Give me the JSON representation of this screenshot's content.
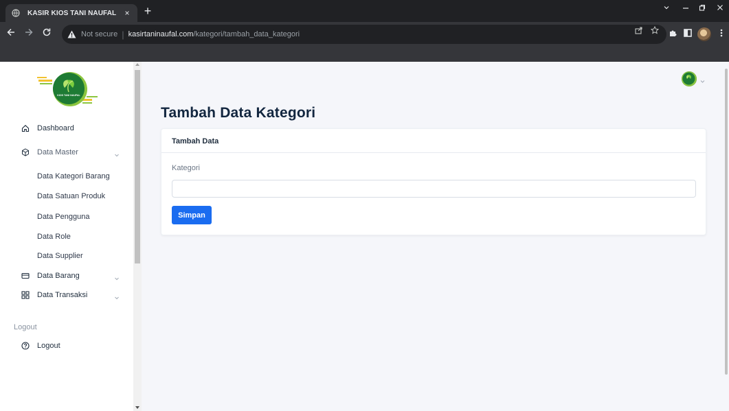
{
  "browser": {
    "tab_title": "KASIR KIOS TANI NAUFAL",
    "tab_close": "×",
    "new_tab": "+",
    "security_label": "Not secure",
    "url_host": "kasirtaninaufal.com",
    "url_path": "/kategori/tambah_data_kategori",
    "separator": "|"
  },
  "sidebar": {
    "logo_text": "KIOS TANI NAUFAL",
    "nav": [
      {
        "label": "Dashboard",
        "icon": "home-icon"
      },
      {
        "label": "Data Master",
        "icon": "cube-icon"
      },
      {
        "label": "Data Kategori Barang"
      },
      {
        "label": "Data Satuan Produk"
      },
      {
        "label": "Data Pengguna"
      },
      {
        "label": "Data Role"
      },
      {
        "label": "Data Supplier"
      },
      {
        "label": "Data Barang",
        "icon": "credit-card-icon"
      },
      {
        "label": "Data Transaksi",
        "icon": "grid-icon"
      }
    ],
    "section_logout": "Logout",
    "logout_label": "Logout"
  },
  "main": {
    "page_title": "Tambah Data Kategori",
    "card_title": "Tambah Data",
    "field_label": "Kategori",
    "field_value": "",
    "field_placeholder": "",
    "save_label": "Simpan"
  },
  "colors": {
    "primary": "#1a6cf0",
    "title": "#12263f",
    "background": "#f5f6fa"
  }
}
